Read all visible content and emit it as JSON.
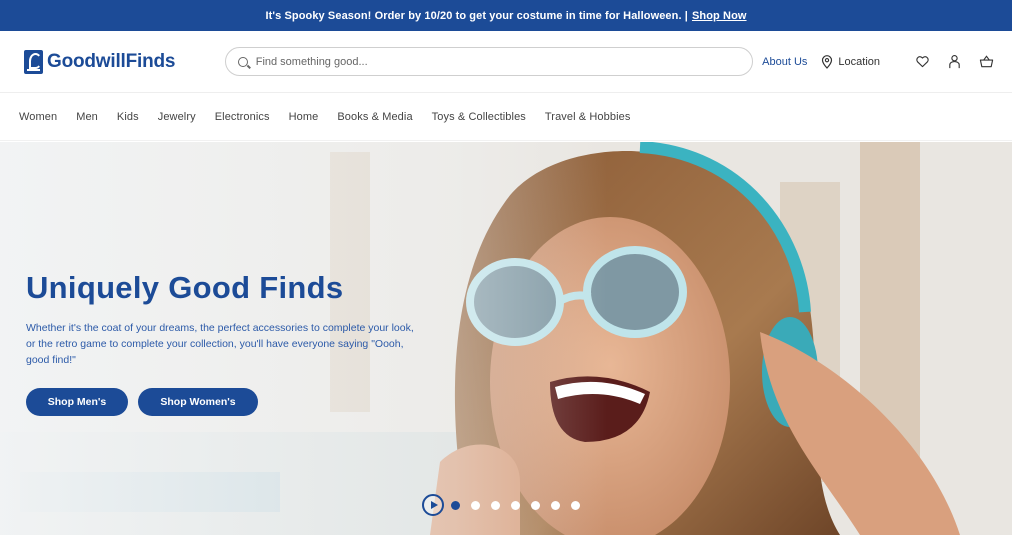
{
  "promo": {
    "text": "It's Spooky Season! Order by 10/20 to get your costume in time for Halloween. |",
    "link": "Shop Now"
  },
  "header": {
    "brand": "GoodwillFinds",
    "search_placeholder": "Find something good...",
    "about": "About Us",
    "location": "Location",
    "icons": [
      "map-pin-icon",
      "heart-icon",
      "user-icon",
      "cart-icon"
    ]
  },
  "nav": {
    "items": [
      "Women",
      "Men",
      "Kids",
      "Jewelry",
      "Electronics",
      "Home",
      "Books & Media",
      "Toys & Collectibles",
      "Travel & Hobbies"
    ]
  },
  "hero": {
    "title": "Uniquely Good Finds",
    "text": "Whether it's the coat of your dreams, the perfect accessories to complete your look, or the retro game to complete your collection, you'll have everyone saying \"Oooh, good find!\"",
    "btn_men": "Shop Men's",
    "btn_women": "Shop Women's"
  },
  "carousel": {
    "slides": 7,
    "active": 1
  },
  "colors": {
    "brand": "#1c4b97"
  }
}
